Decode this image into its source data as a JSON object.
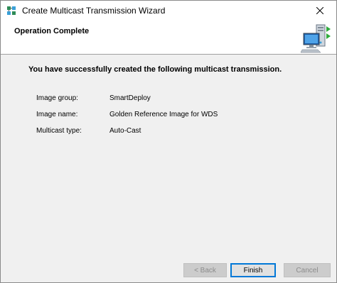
{
  "window": {
    "title": "Create Multicast Transmission Wizard"
  },
  "header": {
    "title": "Operation Complete"
  },
  "content": {
    "message": "You have successfully created the following multicast transmission.",
    "details": [
      {
        "label": "Image group:",
        "value": "SmartDeploy"
      },
      {
        "label": "Image name:",
        "value": "Golden Reference Image for WDS"
      },
      {
        "label": "Multicast type:",
        "value": "Auto-Cast"
      }
    ]
  },
  "buttons": {
    "back": "< Back",
    "finish": "Finish",
    "cancel": "Cancel"
  },
  "icons": {
    "app": "network-wizard-icon",
    "header": "server-network-icon",
    "close": "close-icon"
  },
  "colors": {
    "content_bg": "#f0f0f0",
    "default_button_border": "#0078d7",
    "disabled_text": "#8c8c8c"
  }
}
